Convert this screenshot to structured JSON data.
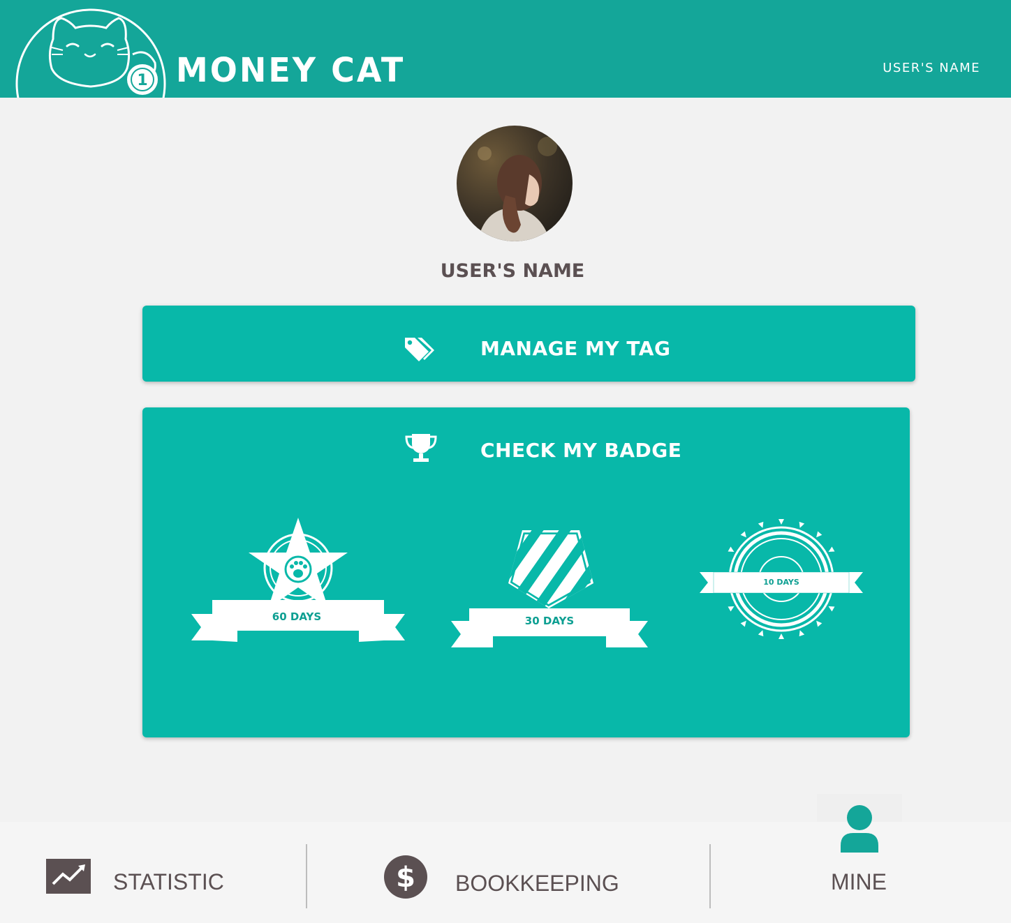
{
  "header": {
    "app_title": "MONEY CAT",
    "user_name": "USER'S NAME",
    "logo_icon": "lucky-cat-logo-icon",
    "background_color": "#14a699"
  },
  "profile": {
    "avatar_icon": "user-avatar-photo",
    "name": "USER'S NAME"
  },
  "cards": {
    "tag": {
      "icon": "tags-icon",
      "label": "MANAGE MY TAG"
    },
    "badge": {
      "icon": "trophy-icon",
      "label": "CHECK MY BADGE",
      "badges": [
        {
          "label": "60 DAYS",
          "icon": "star-paw-badge-icon"
        },
        {
          "label": "30 DAYS",
          "icon": "striped-shield-badge-icon"
        },
        {
          "label": "10 DAYS",
          "icon": "sunburst-seal-badge-icon"
        }
      ]
    },
    "background_color": "#08b8a9"
  },
  "bottom_nav": {
    "items": [
      {
        "label": "STATISTIC",
        "icon": "line-chart-icon"
      },
      {
        "label": "BOOKKEEPING",
        "icon": "dollar-coin-icon"
      },
      {
        "label": "MINE",
        "icon": "user-icon",
        "active": true
      }
    ],
    "text_color": "#5b5052",
    "active_color": "#14a699"
  }
}
